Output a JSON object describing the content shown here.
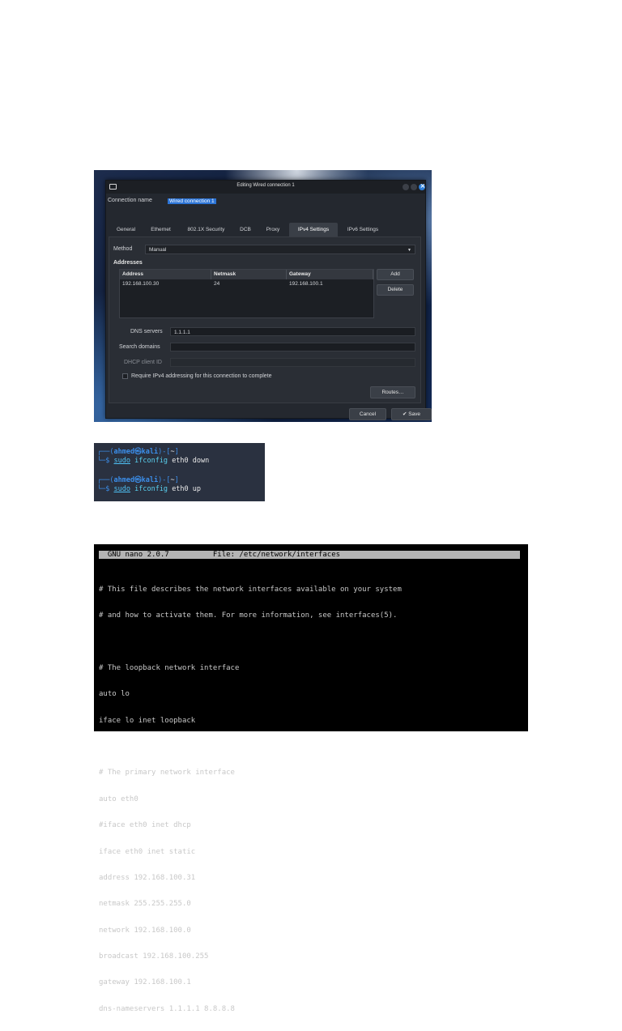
{
  "nm_dialog": {
    "title": "Editing Wired connection 1",
    "connection_name_label": "Connection name",
    "connection_name_value": "Wired connection 1",
    "tabs": [
      "General",
      "Ethernet",
      "802.1X Security",
      "DCB",
      "Proxy",
      "IPv4 Settings",
      "IPv6 Settings"
    ],
    "active_tab": "IPv4 Settings",
    "method_label": "Method",
    "method_value": "Manual",
    "addresses_label": "Addresses",
    "table_headers": [
      "Address",
      "Netmask",
      "Gateway"
    ],
    "table_rows": [
      [
        "192.168.100.30",
        "24",
        "192.168.100.1"
      ]
    ],
    "add_label": "Add",
    "delete_label": "Delete",
    "dns_label": "DNS servers",
    "dns_value": "1.1.1.1",
    "search_domains_label": "Search domains",
    "search_domains_value": "",
    "dhcp_client_id_label": "DHCP client ID",
    "dhcp_client_id_value": "",
    "require_ipv4_label": "Require IPv4 addressing for this connection to complete",
    "require_ipv4_checked": false,
    "routes_label": "Routes…",
    "cancel_label": "Cancel",
    "save_label": "✔ Save",
    "accent_color": "#2c74d6"
  },
  "terminal": {
    "line1_open": "┌──(",
    "user": "ahmed",
    "at": "㉿",
    "host": "kali",
    "line1_close": ")-[",
    "cwd": "~",
    "line1_end": "]",
    "line2_prefix": "└─",
    "prompt": "$",
    "sudo": "sudo",
    "cmd": "ifconfig",
    "args1": "eth0 down",
    "args2": "eth0 up"
  },
  "nano": {
    "header_left": "GNU nano 2.0.7",
    "header_file": "File: /etc/network/interfaces",
    "lines": [
      "# This file describes the network interfaces available on your system",
      "# and how to activate them. For more information, see interfaces(5).",
      "",
      "# The loopback network interface",
      "auto lo",
      "iface lo inet loopback",
      "",
      "# The primary network interface",
      "auto eth0",
      "#iface eth0 inet dhcp",
      "iface eth0 inet static",
      "address 192.168.100.31",
      "netmask 255.255.255.0",
      "network 192.168.100.0",
      "broadcast 192.168.100.255",
      "gateway 192.168.100.1",
      "dns-nameservers 1.1.1.1 8.8.8.8"
    ]
  }
}
